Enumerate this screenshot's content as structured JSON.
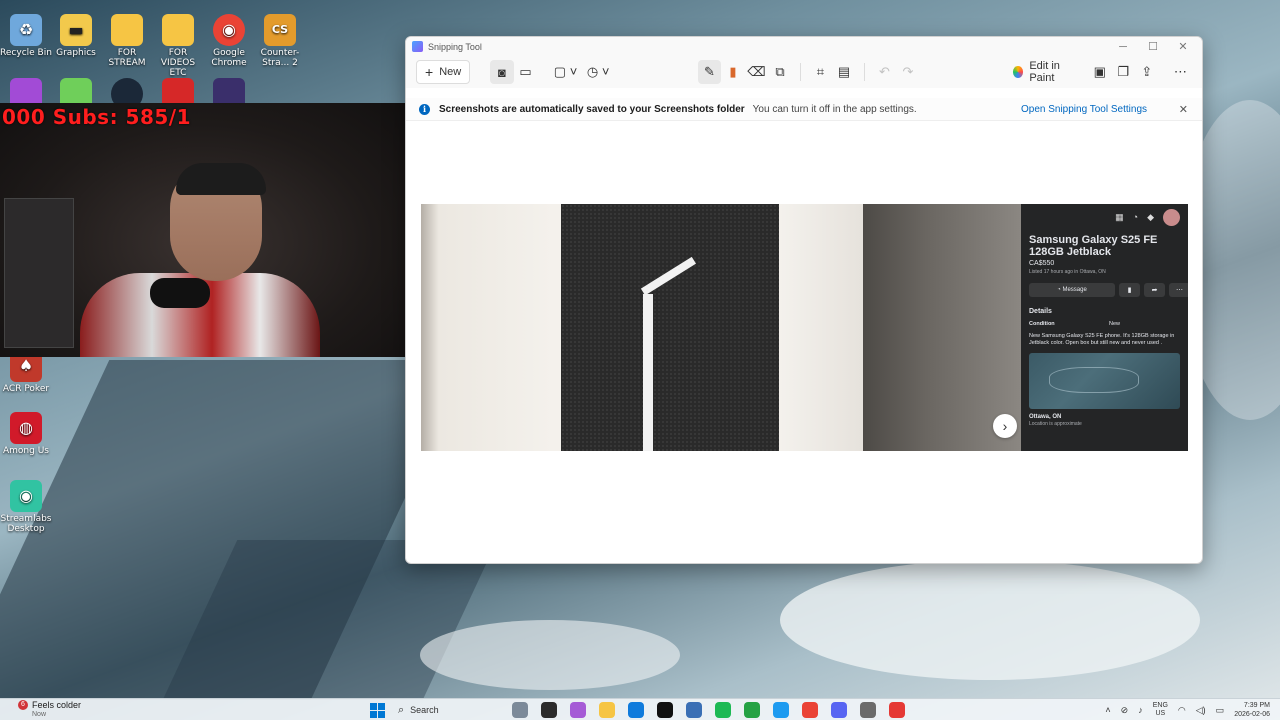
{
  "desktop": {
    "icons": [
      {
        "label": "Recycle Bin",
        "glyph": "♻",
        "color": "#6fa8dc"
      },
      {
        "label": "Graphics",
        "glyph": "▬",
        "color": "#f2c94c"
      },
      {
        "label": "FOR STREAM",
        "glyph": "",
        "color": "#f6c544"
      },
      {
        "label": "FOR VIDEOS ETC",
        "glyph": "",
        "color": "#f6c544"
      },
      {
        "label": "Google Chrome",
        "glyph": "◉",
        "color": "#ea4335"
      },
      {
        "label": "Counter-Stra... 2",
        "glyph": "CS",
        "color": "#e39b2c"
      },
      {
        "label": "ACR Poker",
        "glyph": "♠",
        "color": "#c0392b"
      },
      {
        "label": "Among Us",
        "glyph": "◍",
        "color": "#d11a2a"
      },
      {
        "label": "Streamlabs Desktop",
        "glyph": "◉",
        "color": "#31c3a2"
      }
    ],
    "extra_icons": [
      "uno-icon",
      "app-icon"
    ]
  },
  "webcam": {
    "overlay_text": "000  Subs: 585/1"
  },
  "snipping_tool": {
    "title": "Snipping Tool",
    "toolbar": {
      "new_label": "New",
      "edit_in_paint_label": "Edit in Paint"
    },
    "info_bar": {
      "bold_text": "Screenshots are automatically saved to your Screenshots folder",
      "message": "You can turn it off in the app settings.",
      "link": "Open Snipping Tool Settings"
    },
    "listing": {
      "title": "Samsung Galaxy S25 FE 128GB Jetblack",
      "price": "CA$550",
      "listed": "Listed 17 hours ago in Ottawa, ON",
      "message_button": "Message",
      "details_heading": "Details",
      "condition_label": "Condition",
      "condition_value": "New",
      "description": "New Samsung Galaxy S25 FE phone. It's 128GB storage in Jetblack color. Open box but still new and never used .",
      "location": "Ottawa, ON",
      "location_note": "Location is approximate"
    }
  },
  "taskbar": {
    "weather_badge": "6",
    "weather_text": "Feels colder",
    "weather_sub": "Now",
    "search_placeholder": "Search",
    "lang_1": "ENG",
    "lang_2": "US",
    "time": "7:39 PM",
    "date": "2026-02-06",
    "app_colors": [
      "#7c8a99",
      "#2b2b2b",
      "#a55bd6",
      "#f6c544",
      "#0f7bdc",
      "#111111",
      "#3a6fb5",
      "#1db954",
      "#25a244",
      "#1d9bf0",
      "#ea4335",
      "#5865f2",
      "#6b6b6b",
      "#e53935"
    ]
  }
}
